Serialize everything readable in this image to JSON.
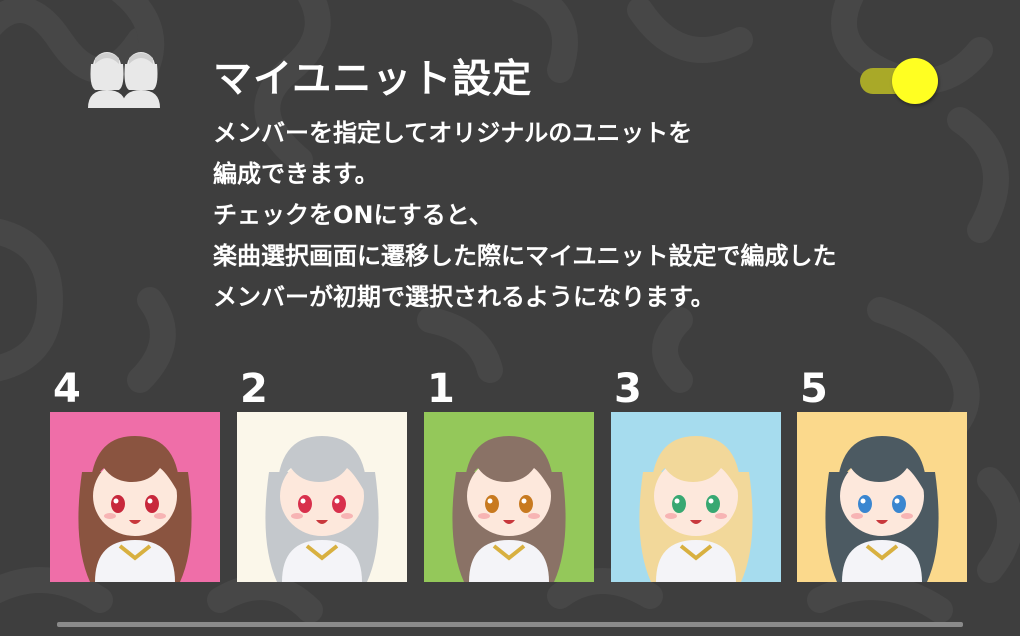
{
  "setting": {
    "title": "マイユニット設定",
    "icon": "two-people-icon",
    "toggle_state": "on",
    "description_lines": [
      "メンバーを指定してオリジナルのユニットを",
      "編成できます。",
      "チェックをONにすると、",
      "楽曲選択画面に遷移した際にマイユニット設定で編成した",
      "メンバーが初期で選択されるようになります。"
    ]
  },
  "members": [
    {
      "order": "4",
      "card_color": "#ef6ea8",
      "hair_color": "#8a5440",
      "eye_color": "#c8283c"
    },
    {
      "order": "2",
      "card_color": "#fbf7ea",
      "hair_color": "#c4c8cc",
      "eye_color": "#d8304c"
    },
    {
      "order": "1",
      "card_color": "#94c85a",
      "hair_color": "#8a7266",
      "eye_color": "#c87a20"
    },
    {
      "order": "3",
      "card_color": "#a6dcee",
      "hair_color": "#f2d89a",
      "eye_color": "#38a872"
    },
    {
      "order": "5",
      "card_color": "#fbd98c",
      "hair_color": "#4c5a62",
      "eye_color": "#3a86d0"
    }
  ],
  "colors": {
    "background": "#3e3e3e",
    "toggle_on": "#ffff22",
    "toggle_track": "#a9a928"
  }
}
